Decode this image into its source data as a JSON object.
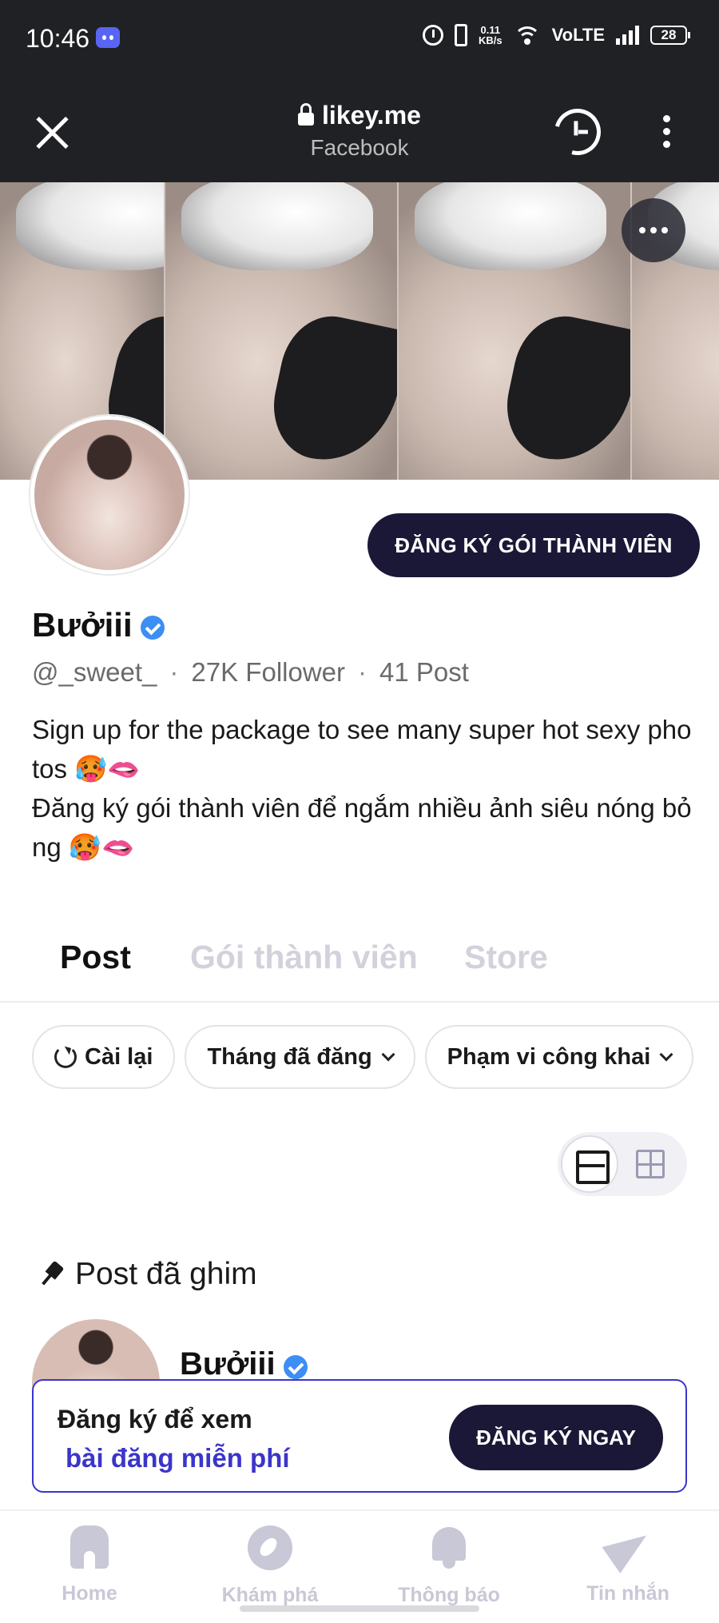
{
  "status_bar": {
    "time": "10:46",
    "speed_top": "0.11",
    "speed_unit": "KB/s",
    "network": "VoLTE",
    "battery": "28",
    "icons": [
      "discord-icon",
      "alarm-icon",
      "vibrate-icon",
      "wifi-icon",
      "signal-icon",
      "battery-icon"
    ]
  },
  "browser": {
    "domain": "likey.me",
    "subtitle": "Facebook",
    "icons": [
      "close-icon",
      "lock-icon",
      "history-icon",
      "more-vert-icon"
    ]
  },
  "profile": {
    "subscribe_label": "ĐĂNG KÝ GÓI THÀNH VIÊN",
    "name": "Bưởiii",
    "handle": "@_sweet_",
    "followers": "27K Follower",
    "posts": "41 Post",
    "bio_line_1": "Sign up for the package to see many super hot sexy photos 🥵🫦",
    "bio_line_2": "Đăng ký gói thành viên để ngắm nhiều ảnh siêu nóng bỏng 🥵🫦"
  },
  "tabs": [
    {
      "label": "Post",
      "active": true
    },
    {
      "label": "Gói thành viên",
      "active": false
    },
    {
      "label": "Store",
      "active": false
    }
  ],
  "filters": {
    "reset": "Cài lại",
    "month": "Tháng đã đăng",
    "scope": "Phạm vi công khai"
  },
  "pinned": {
    "label": "Post đã ghim",
    "author": "Bưởiii"
  },
  "signup_banner": {
    "line_1": "Đăng ký để xem",
    "line_2": "bài đăng miễn phí",
    "button": "ĐĂNG KÝ NGAY"
  },
  "bottom_nav": [
    {
      "label": "Home",
      "icon": "home-icon"
    },
    {
      "label": "Khám phá",
      "icon": "compass-icon"
    },
    {
      "label": "Thông báo",
      "icon": "bell-icon"
    },
    {
      "label": "Tin nhắn",
      "icon": "send-icon"
    }
  ],
  "colors": {
    "brand_dark": "#1b1737",
    "accent_blue": "#3b35c9",
    "verified": "#3d8ef5",
    "inactive": "#c8c8d6"
  }
}
